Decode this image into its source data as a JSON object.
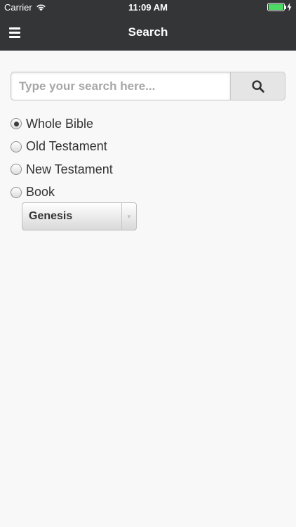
{
  "status_bar": {
    "carrier": "Carrier",
    "time": "11:09 AM",
    "battery_level": 1.0,
    "battery_color": "#4cd964"
  },
  "header": {
    "title": "Search",
    "menu_icon": "hamburger-menu-icon"
  },
  "search": {
    "placeholder": "Type your search here...",
    "value": "",
    "button_icon": "search-icon"
  },
  "scope": {
    "options": [
      {
        "label": "Whole Bible",
        "checked": true
      },
      {
        "label": "Old Testament",
        "checked": false
      },
      {
        "label": "New Testament",
        "checked": false
      },
      {
        "label": "Book",
        "checked": false
      }
    ]
  },
  "book_select": {
    "selected": "Genesis"
  },
  "colors": {
    "header_bg": "#343537",
    "page_bg": "#f8f8f8"
  }
}
